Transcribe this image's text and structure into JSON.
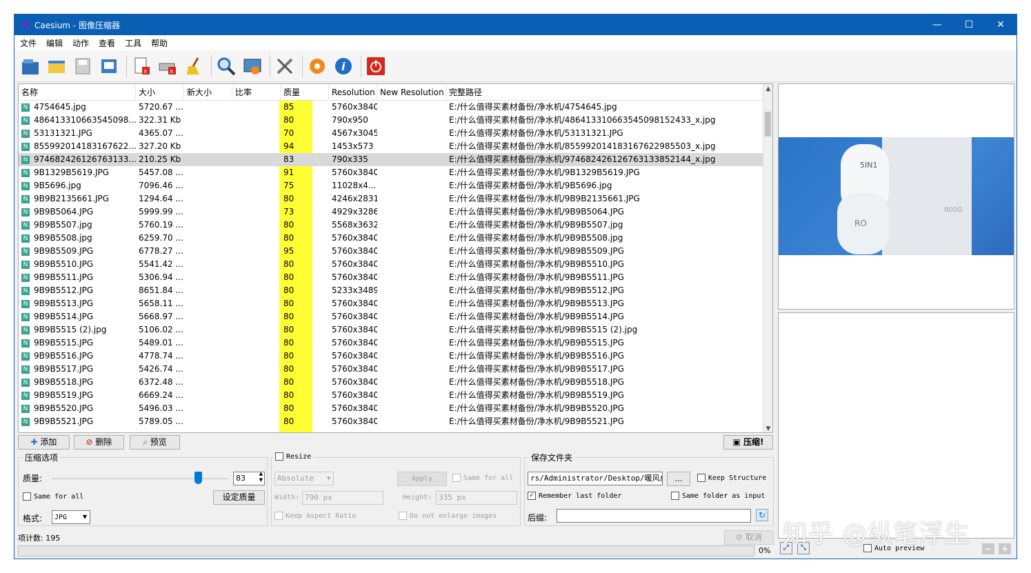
{
  "window": {
    "title": "Caesium - 图像压缩器",
    "minimize": "—",
    "maximize": "☐",
    "close": "✕"
  },
  "menu": [
    "文件",
    "编辑",
    "动作",
    "查看",
    "工具",
    "帮助"
  ],
  "toolbar_icons": [
    "open-file-icon",
    "open-folder-icon",
    "save-icon",
    "save-list-icon",
    "remove-item-icon",
    "clear-list-icon",
    "broom-icon",
    "search-icon",
    "preview-icon",
    "tools-icon",
    "settings-icon",
    "info-icon",
    "power-icon"
  ],
  "columns": [
    "名称",
    "大小",
    "新大小",
    "比率",
    "质量",
    "Resolution",
    "New Resolution",
    "完整路径"
  ],
  "rows": [
    {
      "name": "4754645.jpg",
      "size": "5720.67 ...",
      "quality": "85",
      "res": "5760x3840",
      "path": "E:/什么值得买素材备份/净水机/4754645.jpg"
    },
    {
      "name": "486413310663545098...",
      "size": "322.31 Kb",
      "quality": "80",
      "res": "790x950",
      "path": "E:/什么值得买素材备份/净水机/486413310663545098152433_x.jpg"
    },
    {
      "name": "53131321.JPG",
      "size": "4365.07 ...",
      "quality": "70",
      "res": "4567x3045",
      "path": "E:/什么值得买素材备份/净水机/53131321.JPG"
    },
    {
      "name": "855992014183167622...",
      "size": "327.20 Kb",
      "quality": "94",
      "res": "1453x573",
      "path": "E:/什么值得买素材备份/净水机/855992014183167622985503_x.jpg"
    },
    {
      "name": "974682426126763133...",
      "size": "210.25 Kb",
      "quality": "83",
      "res": "790x335",
      "path": "E:/什么值得买素材备份/净水机/974682426126763133852144_x.jpg",
      "selected": true
    },
    {
      "name": "9B1329B5619.JPG",
      "size": "5457.08 ...",
      "quality": "91",
      "res": "5760x3840",
      "path": "E:/什么值得买素材备份/净水机/9B1329B5619.JPG"
    },
    {
      "name": "9B5696.jpg",
      "size": "7096.46 ...",
      "quality": "75",
      "res": "11028x4...",
      "path": "E:/什么值得买素材备份/净水机/9B5696.jpg"
    },
    {
      "name": "9B9B2135661.JPG",
      "size": "1294.64 ...",
      "quality": "80",
      "res": "4246x2831",
      "path": "E:/什么值得买素材备份/净水机/9B9B2135661.JPG"
    },
    {
      "name": "9B9B5064.JPG",
      "size": "5999.99 ...",
      "quality": "73",
      "res": "4929x3286",
      "path": "E:/什么值得买素材备份/净水机/9B9B5064.JPG"
    },
    {
      "name": "9B9B5507.jpg",
      "size": "5760.19 ...",
      "quality": "80",
      "res": "5568x3632",
      "path": "E:/什么值得买素材备份/净水机/9B9B5507.jpg"
    },
    {
      "name": "9B9B5508.jpg",
      "size": "6259.70 ...",
      "quality": "80",
      "res": "5760x3840",
      "path": "E:/什么值得买素材备份/净水机/9B9B5508.jpg"
    },
    {
      "name": "9B9B5509.JPG",
      "size": "6778.27 ...",
      "quality": "95",
      "res": "5760x3840",
      "path": "E:/什么值得买素材备份/净水机/9B9B5509.JPG"
    },
    {
      "name": "9B9B5510.JPG",
      "size": "5541.42 ...",
      "quality": "80",
      "res": "5760x3840",
      "path": "E:/什么值得买素材备份/净水机/9B9B5510.JPG"
    },
    {
      "name": "9B9B5511.JPG",
      "size": "5306.94 ...",
      "quality": "80",
      "res": "5760x3840",
      "path": "E:/什么值得买素材备份/净水机/9B9B5511.JPG"
    },
    {
      "name": "9B9B5512.JPG",
      "size": "8651.84 ...",
      "quality": "80",
      "res": "5233x3489",
      "path": "E:/什么值得买素材备份/净水机/9B9B5512.JPG"
    },
    {
      "name": "9B9B5513.JPG",
      "size": "5658.11 ...",
      "quality": "80",
      "res": "5760x3840",
      "path": "E:/什么值得买素材备份/净水机/9B9B5513.JPG"
    },
    {
      "name": "9B9B5514.JPG",
      "size": "5668.97 ...",
      "quality": "80",
      "res": "5760x3840",
      "path": "E:/什么值得买素材备份/净水机/9B9B5514.JPG"
    },
    {
      "name": "9B9B5515 (2).jpg",
      "size": "5106.02 ...",
      "quality": "80",
      "res": "5760x3840",
      "path": "E:/什么值得买素材备份/净水机/9B9B5515 (2).jpg"
    },
    {
      "name": "9B9B5515.JPG",
      "size": "5489.01 ...",
      "quality": "80",
      "res": "5760x3840",
      "path": "E:/什么值得买素材备份/净水机/9B9B5515.JPG"
    },
    {
      "name": "9B9B5516.JPG",
      "size": "4778.74 ...",
      "quality": "80",
      "res": "5760x3840",
      "path": "E:/什么值得买素材备份/净水机/9B9B5516.JPG"
    },
    {
      "name": "9B9B5517.JPG",
      "size": "5426.74 ...",
      "quality": "80",
      "res": "5760x3840",
      "path": "E:/什么值得买素材备份/净水机/9B9B5517.JPG"
    },
    {
      "name": "9B9B5518.JPG",
      "size": "6372.48 ...",
      "quality": "80",
      "res": "5760x3840",
      "path": "E:/什么值得买素材备份/净水机/9B9B5518.JPG"
    },
    {
      "name": "9B9B5519.JPG",
      "size": "6669.24 ...",
      "quality": "80",
      "res": "5760x3840",
      "path": "E:/什么值得买素材备份/净水机/9B9B5519.JPG"
    },
    {
      "name": "9B9B5520.JPG",
      "size": "5496.03 ...",
      "quality": "80",
      "res": "5760x3840",
      "path": "E:/什么值得买素材备份/净水机/9B9B5520.JPG"
    },
    {
      "name": "9B9B5521.JPG",
      "size": "5789.05 ...",
      "quality": "80",
      "res": "5760x3840",
      "path": "E:/什么值得买素材备份/净水机/9B9B5521.JPG"
    }
  ],
  "row_icon": "N",
  "list_buttons": {
    "add": "添加",
    "remove": "删除",
    "preview": "预览",
    "compress": "压缩!"
  },
  "compress_options": {
    "group": "压缩选项",
    "quality_label": "质量:",
    "quality_value": "83",
    "quality_fraction": 0.83,
    "same_for_all": "Same for all",
    "set_quality": "设定质量",
    "format_label": "格式:",
    "format_value": "JPG"
  },
  "resize": {
    "label": "Resize",
    "mode": "Absolute",
    "apply": "Apply",
    "same_for_all": "Same for all",
    "width_label": "Width:",
    "width_value": "790 px",
    "height_label": "Height:",
    "height_value": "335 px",
    "keep_aspect": "Keep Aspect Ratio",
    "no_enlarge": "Do not enlarge images"
  },
  "save": {
    "group": "保存文件夹",
    "path": "rs/Administrator/Desktop/暖风桌s",
    "browse": "...",
    "keep_structure": "Keep Structure",
    "remember_last": "Remember last folder",
    "same_as_input": "Same folder as input",
    "suffix_label": "后缀:",
    "suffix_value": ""
  },
  "status": {
    "count": "项计数: 195",
    "cancel": "取消",
    "progress_pct": "0%",
    "progress_fraction": 0.0
  },
  "preview_panel": {
    "auto_preview": "Auto preview",
    "product_label_1": "5IN1",
    "product_label_2": "RO",
    "product_label_3": "800G"
  },
  "watermark": "知乎 @纵笔浮生",
  "colors": {
    "titlebar": "#0a5fb5",
    "quality_highlight": "#ffff33",
    "selected_row": "#d9d9d9"
  }
}
